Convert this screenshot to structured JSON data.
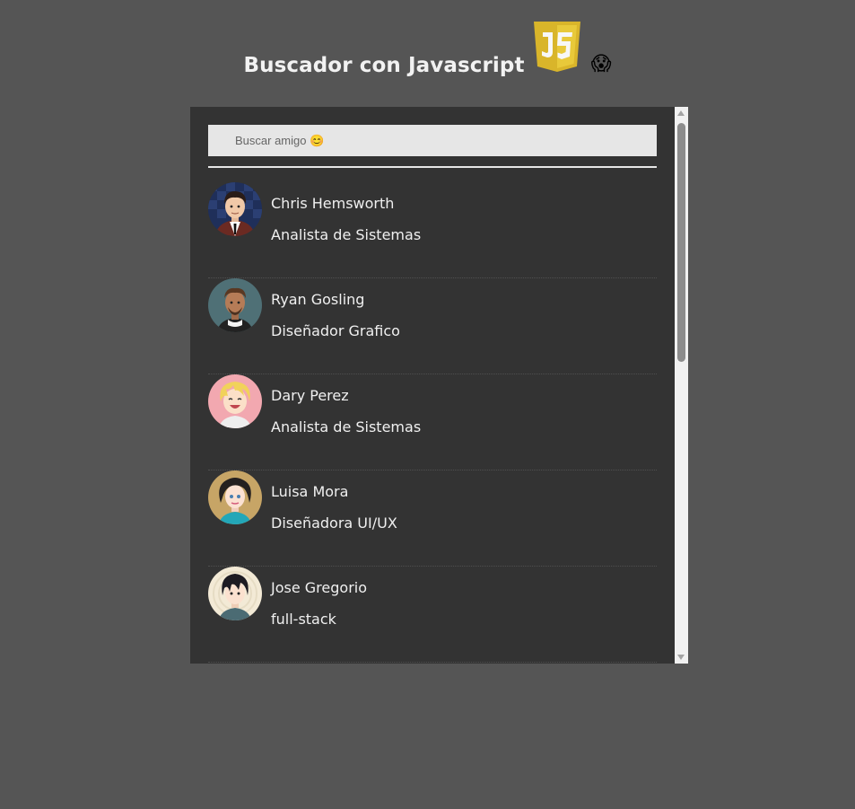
{
  "header": {
    "title": "Buscador con Javascript",
    "logo_icon": "javascript-logo-icon",
    "emoji": "😱"
  },
  "search": {
    "placeholder": "Buscar amigo 😊",
    "value": ""
  },
  "friends": [
    {
      "name": "Chris Hemsworth",
      "role": "Analista de Sistemas",
      "avatar": "avatar-man-suit"
    },
    {
      "name": "Ryan Gosling",
      "role": "Diseñador Grafico",
      "avatar": "avatar-man-beard"
    },
    {
      "name": "Dary Perez",
      "role": "Analista de Sistemas",
      "avatar": "avatar-blonde-laughing"
    },
    {
      "name": "Luisa Mora",
      "role": "Diseñadora UI/UX",
      "avatar": "avatar-woman-curly"
    },
    {
      "name": "Jose Gregorio",
      "role": "full-stack",
      "avatar": "avatar-man-dark-hair"
    }
  ],
  "colors": {
    "page_bg": "#555555",
    "panel_bg": "#333333",
    "text": "#f0f0f0",
    "search_bg": "#e6e6e6",
    "js_yellow": "#e2c22e"
  }
}
